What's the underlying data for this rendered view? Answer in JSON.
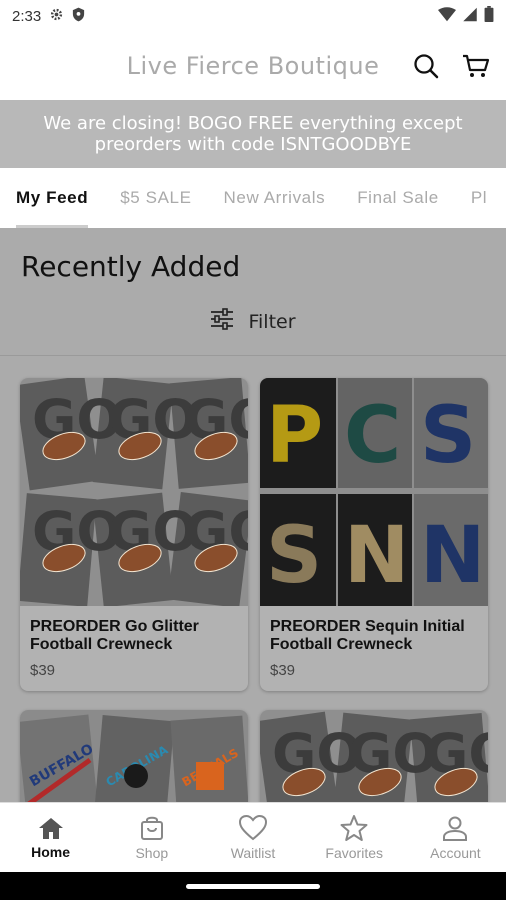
{
  "status_bar": {
    "time": "2:33"
  },
  "header": {
    "title": "Live Fierce Boutique"
  },
  "banner": {
    "line1": "We are closing! BOGO FREE everything except",
    "line2": "preorders with code ISNTGOODBYE"
  },
  "tabs": [
    {
      "label": "My Feed",
      "active": true
    },
    {
      "label": "$5 SALE"
    },
    {
      "label": "New Arrivals"
    },
    {
      "label": "Final Sale"
    },
    {
      "label": "Pl"
    }
  ],
  "main": {
    "section_title": "Recently Added",
    "filter_label": "Filter",
    "products": [
      {
        "name_line1": "PREORDER Go Glitter",
        "name_line2": "Football Crewneck",
        "price": "$39"
      },
      {
        "name_line1": "PREORDER Sequin Initial",
        "name_line2": "Football Crewneck",
        "price": "$39"
      }
    ]
  },
  "bottom_nav": [
    {
      "label": "Home",
      "icon": "home-icon",
      "active": true
    },
    {
      "label": "Shop",
      "icon": "shopping-bag-icon"
    },
    {
      "label": "Waitlist",
      "icon": "heart-icon"
    },
    {
      "label": "Favorites",
      "icon": "star-icon"
    },
    {
      "label": "Account",
      "icon": "person-icon"
    }
  ],
  "colors": {
    "banner_bg": "#b8b8b8",
    "content_bg": "#ababab",
    "title_gray": "#aaaaaa"
  }
}
